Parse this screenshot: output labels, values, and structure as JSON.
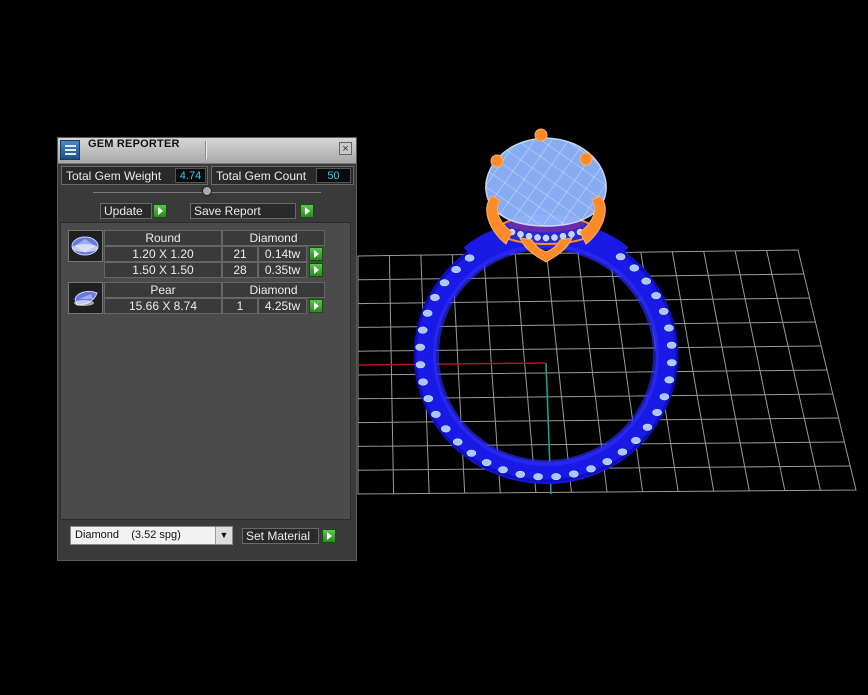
{
  "app": {
    "title": "GEM REPORTER"
  },
  "totals": {
    "weight_label": "Total Gem Weight",
    "weight_value": "4.74",
    "count_label": "Total Gem Count",
    "count_value": "50"
  },
  "toolbar": {
    "update_label": "Update",
    "save_report_label": "Save Report"
  },
  "groups": [
    {
      "shape": "Round",
      "material": "Diamond",
      "rows": [
        {
          "size": "1.20 X 1.20",
          "count": "21",
          "weight": "0.14tw"
        },
        {
          "size": "1.50 X 1.50",
          "count": "28",
          "weight": "0.35tw"
        }
      ]
    },
    {
      "shape": "Pear",
      "material": "Diamond",
      "rows": [
        {
          "size": "15.66 X 8.74",
          "count": "1",
          "weight": "4.25tw"
        }
      ]
    }
  ],
  "material": {
    "selected": "Diamond    (3.52 spg)",
    "set_label": "Set Material"
  },
  "icons": {
    "app": "gem-reporter-icon",
    "close": "close-icon",
    "go": "play-arrow-icon",
    "round_gem": "round-gem-icon",
    "pear_gem": "pear-gem-icon",
    "dropdown": "chevron-down-icon"
  },
  "colors": {
    "panel_bg": "#3a3a3a",
    "value_text": "#2fd0e8",
    "go_button": "#3aa12e",
    "ring_metal": "#1a1ae6",
    "gem_wire": "#9cc8ff",
    "prongs": "#ff8a2a",
    "grid": "#a8a8a8"
  }
}
